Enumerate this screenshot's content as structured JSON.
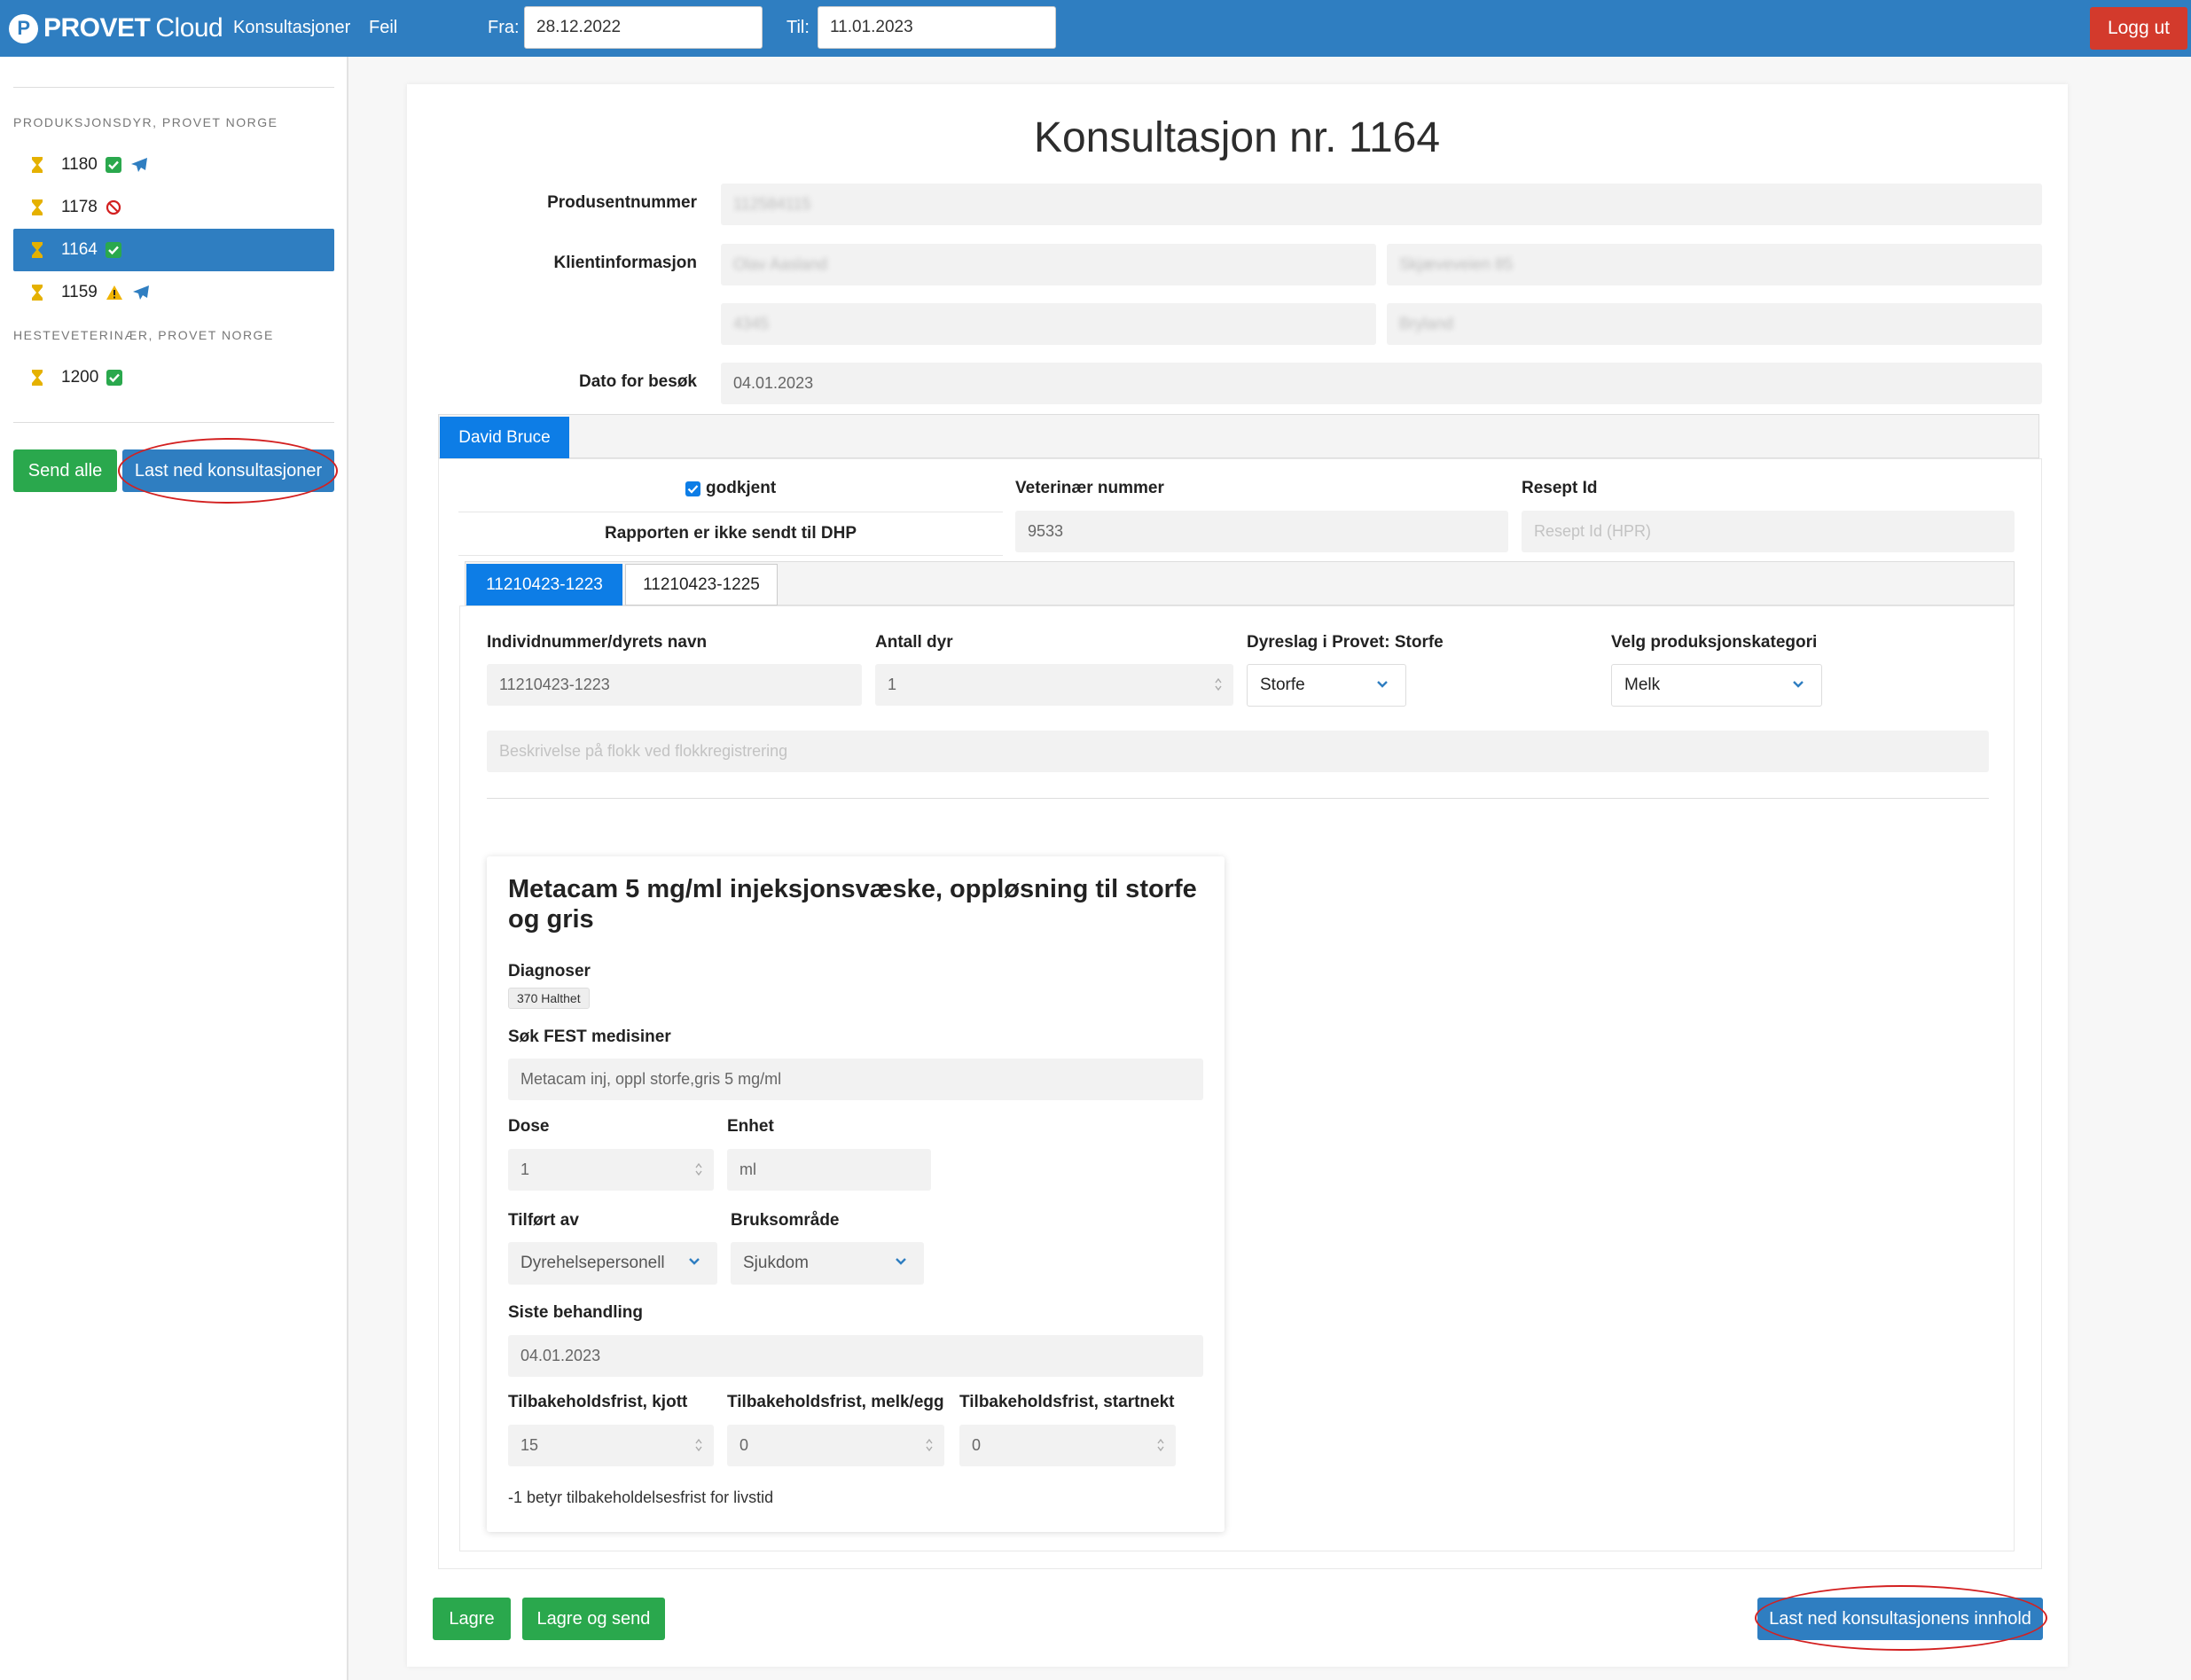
{
  "navbar": {
    "brand_name": "PROVET",
    "brand_suffix": "Cloud",
    "links": [
      "Konsultasjoner",
      "Feil"
    ],
    "from_label": "Fra:",
    "from_value": "28.12.2022",
    "to_label": "Til:",
    "to_value": "11.01.2023",
    "logout_label": "Logg ut"
  },
  "sidebar": {
    "group1_heading": "PRODUKSJONSDYR, PROVET NORGE",
    "group1_items": [
      {
        "number": "1180",
        "status": "approved",
        "sent": true
      },
      {
        "number": "1178",
        "status": "blocked",
        "sent": false
      },
      {
        "number": "1164",
        "status": "approved",
        "sent": false,
        "active": true
      },
      {
        "number": "1159",
        "status": "warning",
        "sent": true
      }
    ],
    "group2_heading": "HESTEVETERINÆR, PROVET NORGE",
    "group2_items": [
      {
        "number": "1200",
        "status": "approved",
        "sent": false
      }
    ],
    "send_all_label": "Send alle",
    "download_label": "Last ned konsultasjoner"
  },
  "consultation": {
    "title": "Konsultasjon nr. 1164",
    "producer_label": "Produsentnummer",
    "producer_value": "112584115",
    "client_label": "Klientinformasjon",
    "client_name": "Olav Aasland",
    "client_street": "Skjæveveien 85",
    "client_zip": "4345",
    "client_city": "Bryland",
    "visit_date_label": "Dato for besøk",
    "visit_date_value": "04.01.2023",
    "vet_tab": "David Bruce",
    "approved_label": "godkjent",
    "not_sent_label": "Rapporten er ikke sendt til DHP",
    "vet_number_label": "Veterinær nummer",
    "vet_number_value": "9533",
    "prescription_label": "Resept Id",
    "prescription_placeholder": "Resept Id (HPR)",
    "animal_tabs": [
      "11210423-1223",
      "11210423-1225"
    ],
    "individual_label": "Individnummer/dyrets navn",
    "individual_value": "11210423-1223",
    "count_label": "Antall dyr",
    "count_value": "1",
    "species_label": "Dyreslag i Provet: Storfe",
    "species_value": "Storfe",
    "category_label": "Velg produksjonskategori",
    "category_value": "Melk",
    "flock_placeholder": "Beskrivelse på flokk ved flokkregistrering",
    "save_label": "Lagre",
    "save_send_label": "Lagre og send",
    "download_content_label": "Last ned konsultasjonens innhold"
  },
  "medicine": {
    "title": "Metacam 5 mg/ml injeksjonsvæske, oppløsning til storfe og gris",
    "diagnoses_label": "Diagnoser",
    "diagnosis_badge": "370 Halthet",
    "fest_label": "Søk FEST medisiner",
    "fest_value": "Metacam inj, oppl storfe,gris 5 mg/ml",
    "dose_label": "Dose",
    "dose_value": "1",
    "unit_label": "Enhet",
    "unit_value": "ml",
    "given_by_label": "Tilført av",
    "given_by_value": "Dyrehelsepersonell",
    "usage_label": "Bruksområde",
    "usage_value": "Sjukdom",
    "last_treatment_label": "Siste behandling",
    "last_treatment_value": "04.01.2023",
    "withdrawal_meat_label": "Tilbakeholdsfrist, kjott",
    "withdrawal_meat_value": "15",
    "withdrawal_milk_label": "Tilbakeholdsfrist, melk/egg",
    "withdrawal_milk_value": "0",
    "withdrawal_start_label": "Tilbakeholdsfrist, startnekt",
    "withdrawal_start_value": "0",
    "note": "-1 betyr tilbakeholdelsesfrist for livstid"
  },
  "colors": {
    "navbar": "#2f7ec1",
    "logout": "#d33a2c",
    "green_button": "#2aa84d",
    "active_tab": "#0d7de6",
    "annotation_ellipse": "#d32020"
  }
}
